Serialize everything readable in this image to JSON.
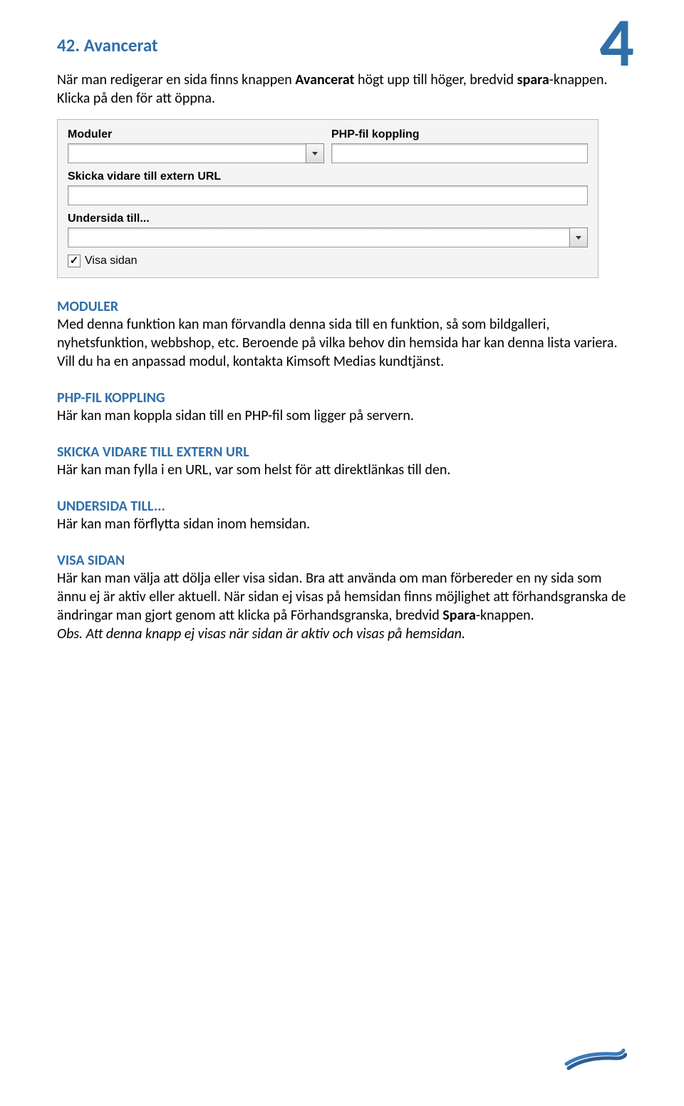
{
  "page_number": "4",
  "heading": "42. Avancerat",
  "intro_pre": "När man redigerar en sida finns knappen ",
  "intro_bold1": "Avancerat",
  "intro_mid": " högt upp till höger, bredvid ",
  "intro_bold2": "spara",
  "intro_post": "-knappen. Klicka på den för att öppna.",
  "form": {
    "moduler_label": "Moduler",
    "php_label": "PHP-fil koppling",
    "url_label": "Skicka vidare till extern URL",
    "undersida_label": "Undersida till...",
    "visa_label": "Visa sidan",
    "checkbox_check": "✓"
  },
  "sections": {
    "moduler": {
      "title": "MODULER",
      "body": "Med denna funktion kan man förvandla denna sida till en funktion, så som bildgalleri, nyhetsfunktion, webbshop, etc. Beroende på vilka behov din hemsida har kan denna lista variera. Vill du ha en anpassad modul, kontakta Kimsoft Medias kundtjänst."
    },
    "php": {
      "title": "PHP-FIL KOPPLING",
      "body": "Här kan man koppla sidan till en PHP-fil som ligger på servern."
    },
    "url": {
      "title": "SKICKA VIDARE TILL EXTERN URL",
      "body": "Här kan man fylla i en URL, var som helst för att direktlänkas till den."
    },
    "undersida": {
      "title": "UNDERSIDA TILL...",
      "body": "Här kan man förflytta sidan inom hemsidan."
    },
    "visa": {
      "title": "VISA SIDAN",
      "body_pre": "Här kan man välja att dölja eller visa sidan. Bra att använda om man förbereder en ny sida som ännu ej är aktiv eller aktuell. När sidan ej visas på hemsidan finns möjlighet att förhandsgranska de ändringar man gjort genom att klicka på Förhandsgranska, bredvid ",
      "body_bold": "Spara",
      "body_post": "-knappen.",
      "note": "Obs. Att denna knapp ej visas när sidan är aktiv och visas på hemsidan."
    }
  }
}
